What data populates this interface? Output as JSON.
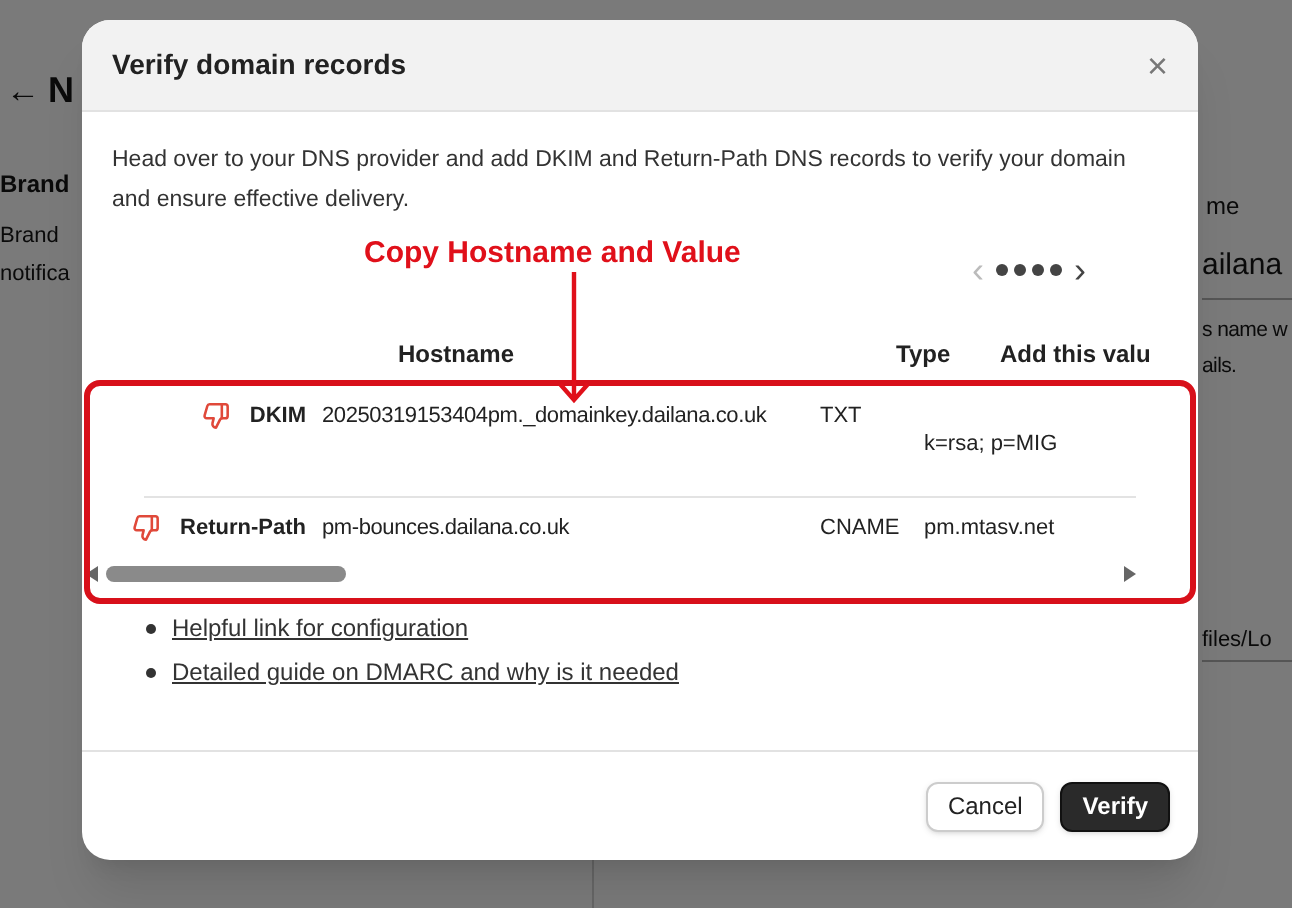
{
  "background": {
    "back_arrow": "←",
    "heading": "N",
    "section_title": "Brand",
    "section_text": [
      "Brand",
      "notifica"
    ],
    "field_label": "me",
    "field_value": "ailana",
    "hint": [
      "s name w",
      "ails."
    ],
    "path_value": "files/Lo"
  },
  "dialog": {
    "title": "Verify domain records",
    "close": "×",
    "intro": "Head over to your DNS provider and add DKIM and Return-Path DNS records to verify your domain and ensure effective delivery.",
    "annotation": "Copy Hostname and Value",
    "pager": {
      "prev": "‹",
      "next": "›",
      "prev_disabled": true
    },
    "table": {
      "columns": [
        "Hostname",
        "Type",
        "Add this valu"
      ],
      "rows": [
        {
          "name": "DKIM",
          "verified": false,
          "hostname": "20250319153404pm._domainkey.dailana.co.uk",
          "type": "TXT",
          "value": "k=rsa; p=MIG"
        },
        {
          "name": "Return-Path",
          "verified": false,
          "hostname": "pm-bounces.dailana.co.uk",
          "type": "CNAME",
          "value": "pm.mtasv.net"
        }
      ]
    },
    "links": [
      "Helpful link for configuration",
      "Detailed guide on DMARC and why is it needed"
    ],
    "buttons": [
      {
        "label": "Cancel",
        "kind": "secondary"
      },
      {
        "label": "Verify",
        "kind": "primary"
      }
    ]
  }
}
